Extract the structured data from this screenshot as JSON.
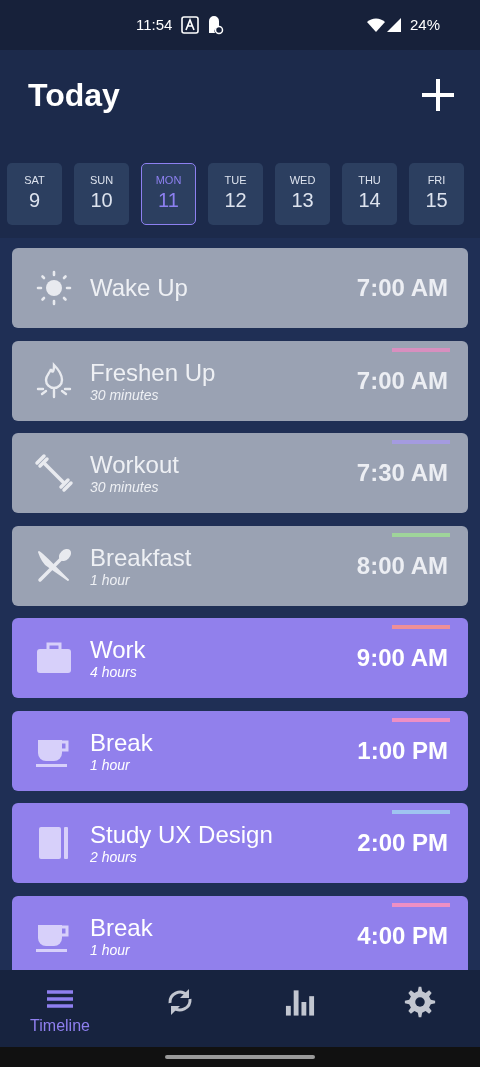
{
  "status_bar": {
    "time": "11:54",
    "battery": "24%"
  },
  "header": {
    "title": "Today"
  },
  "days": [
    {
      "weekday": "SAT",
      "date": "9",
      "selected": false
    },
    {
      "weekday": "SUN",
      "date": "10",
      "selected": false
    },
    {
      "weekday": "MON",
      "date": "11",
      "selected": true
    },
    {
      "weekday": "TUE",
      "date": "12",
      "selected": false
    },
    {
      "weekday": "WED",
      "date": "13",
      "selected": false
    },
    {
      "weekday": "THU",
      "date": "14",
      "selected": false
    },
    {
      "weekday": "FRI",
      "date": "15",
      "selected": false
    }
  ],
  "tasks": [
    {
      "kind": "wake",
      "title": "Wake Up",
      "time": "7:00 AM",
      "past": true
    },
    {
      "kind": "hygiene",
      "title": "Freshen Up",
      "duration": "30 minutes",
      "time": "7:00 AM",
      "past": true,
      "color": "#d88fbf"
    },
    {
      "kind": "exercise",
      "title": "Workout",
      "duration": "30 minutes",
      "time": "7:30 AM",
      "past": true,
      "color": "#a49be0"
    },
    {
      "kind": "meal",
      "title": "Breakfast",
      "duration": "1 hour",
      "time": "8:00 AM",
      "past": true,
      "color": "#9fd49a"
    },
    {
      "kind": "work",
      "title": "Work",
      "duration": "4 hours",
      "time": "9:00 AM",
      "past": false,
      "color": "#ee8f98"
    },
    {
      "kind": "break",
      "title": "Break",
      "duration": "1 hour",
      "time": "1:00 PM",
      "past": false,
      "color": "#ee8fc4"
    },
    {
      "kind": "study",
      "title": "Study UX Design",
      "duration": "2 hours",
      "time": "2:00 PM",
      "past": false,
      "color": "#9fc4f0"
    },
    {
      "kind": "break",
      "title": "Break",
      "duration": "1 hour",
      "time": "4:00 PM",
      "past": false,
      "color": "#ee8fc4"
    }
  ],
  "nav": [
    {
      "kind": "timeline",
      "label": "Timeline",
      "selected": true
    },
    {
      "kind": "sync",
      "selected": false
    },
    {
      "kind": "stats",
      "selected": false
    },
    {
      "kind": "settings",
      "selected": false
    }
  ]
}
